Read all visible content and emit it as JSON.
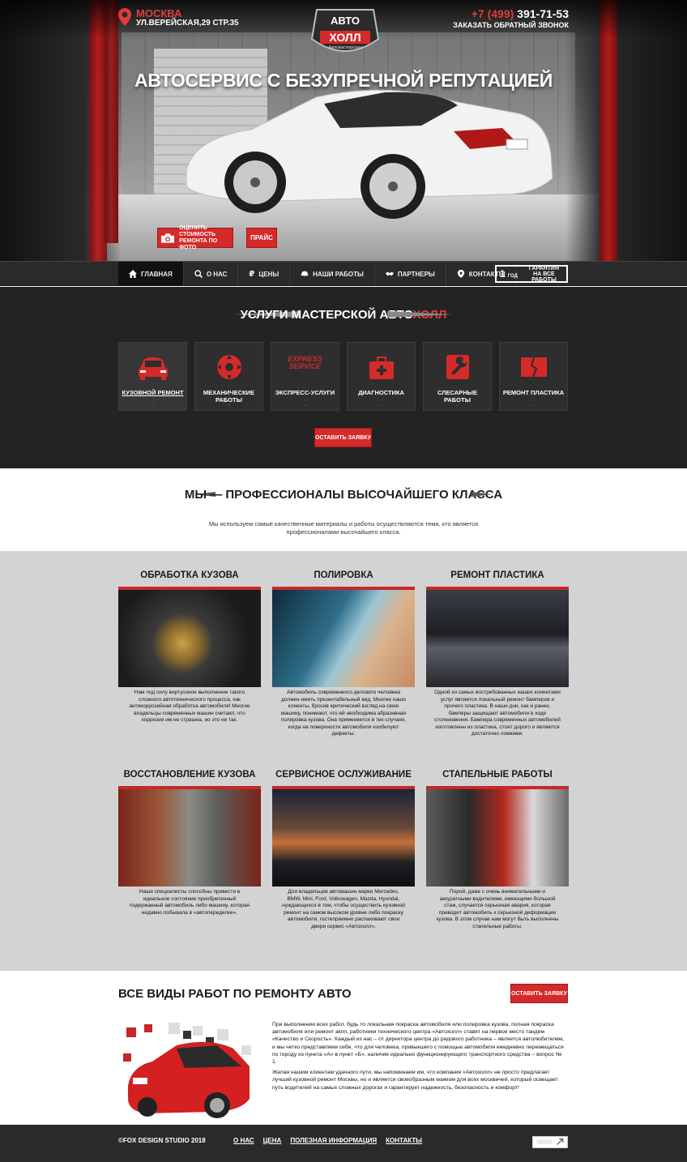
{
  "header": {
    "city": "МОСКВА",
    "address": "УЛ.ВЕРЕЙСКАЯ,29 СТР.35",
    "phone_prefix": "+7 (499)",
    "phone_number": "391-71-53",
    "callback": "ЗАКАЗАТЬ ОБРАТНЫЙ ЗВОНОК",
    "logo_top": "АВТО",
    "logo_bottom": "ХОЛЛ",
    "logo_sub": "Автомастерская"
  },
  "hero": {
    "title": "АВТОСЕРВИС С БЕЗУПРЕЧНОЙ РЕПУТАЦИЕЙ",
    "estimate_line1": "ОЦЕНИТЬ СТОИМОСТЬ",
    "estimate_line2": "РЕМОНТА ПО ФОТО",
    "price_btn": "ПРАЙС"
  },
  "nav": {
    "items": [
      {
        "label": "ГЛАВНАЯ",
        "icon": "home-icon"
      },
      {
        "label": "О НАС",
        "icon": "search-icon"
      },
      {
        "label": "ЦЕНЫ",
        "icon": "ruble-icon"
      },
      {
        "label": "НАШИ РАБОТЫ",
        "icon": "car-icon"
      },
      {
        "label": "ПАРТНЕРЫ",
        "icon": "handshake-icon"
      },
      {
        "label": "КОНТАКТЫ",
        "icon": "pin-icon"
      }
    ],
    "warranty_num": "1",
    "warranty_unit": "ГОД",
    "warranty_line1": "ГАРАНТИЯ",
    "warranty_line2": "НА ВСЕ РАБОТЫ"
  },
  "services": {
    "title_a": "УСЛУГИ МАСТЕРСКОЙ ",
    "title_b": "АВТО",
    "title_c": "ХОЛЛ",
    "express_line1": "EXPRESS",
    "express_line2": "SERVICE",
    "tiles": [
      {
        "label": "КУЗОВНОЙ РЕМОНТ",
        "icon": "car-front-icon"
      },
      {
        "label": "МЕХАНИЧЕСКИЕ РАБОТЫ",
        "icon": "saw-blade-icon"
      },
      {
        "label": "ЭКСПРЕСС-УСЛУГИ",
        "icon": "express-service-icon"
      },
      {
        "label": "ДИАГНОСТИКА",
        "icon": "first-aid-kit-icon"
      },
      {
        "label": "СЛЕСАРНЫЕ РАБОТЫ",
        "icon": "wrench-icon"
      },
      {
        "label": "РЕМОНТ ПЛАСТИКА",
        "icon": "plastic-panel-icon"
      }
    ],
    "order_btn": "ОСТАВИТЬ ЗАЯВКУ"
  },
  "pro": {
    "title": "МЫ — ПРОФЕССИОНАЛЫ ВЫСОЧАЙШЕГО КЛАССА",
    "desc": "Мы используем самые качественные материалы и работы осуществляются теми, кто является профессионалами высочайшего класса."
  },
  "cards": [
    {
      "title": "ОБРАБОТКА КУЗОВА",
      "text": "Нам под силу виртуозное выполнение такого сложного автотехнического процесса, как антикоррозийная обработка автомобиля! Многие владельцы современных машин считают, что коррозия им не страшна, но это не так."
    },
    {
      "title": "ПОЛИРОВКА",
      "text": "Автомобиль современного делового человека должен иметь презентабельный вид. Многие наши клиенты, бросив критический взгляд на свою машину, понимают, что ей необходима абразивная полировка кузова. Она применяется в тех случаях, когда на поверхности автомобиля изобилуют дефекты."
    },
    {
      "title": "РЕМОНТ ПЛАСТИКА",
      "text": "Одной из самых востребованных наших клиентами услуг является локальный ремонт бамперов и прочего пластика. В наши дни, как и ранее, бамперы защищают автомобили в ходе столкновения. Бампера современных автомобилей изготовлены из пластика, стоят дорого и являются достаточно ломкими."
    },
    {
      "title": "ВОССТАНОВЛЕНИЕ КУЗОВА",
      "text": "Наши специалисты способны привести в идеальное состояние приобретенный подержанный автомобиль либо машину, которая недавно побывала в «автопеределке»."
    },
    {
      "title": "СЕРВИСНОЕ ОСЛУЖИВАНИЕ",
      "text": "Для владельцев автомашин марки Mercedes, BMW, Mini, Ford, Volkswagen, Mazda, Hyundai, нуждающихся в том, чтобы осуществить кузовной ремонт на самом высоком уровне либо покраску автомобиля, гостеприимно распахивают свои двери сервис «Автохолл»."
    },
    {
      "title": "СТАПЕЛЬНЫЕ РАБОТЫ",
      "text": "Порой, даже с очень внимательными и аккуратными водителями, имеющими большой стаж, случается серьезная авария, которая приводит автомобиль к серьезной деформации кузова. В этом случае нам могут быть выполнены стапельные работы."
    }
  ],
  "works": {
    "title": "ВСЕ ВИДЫ РАБОТ ПО РЕМОНТУ АВТО",
    "order_btn": "ОСТАВИТЬ ЗАЯВКУ",
    "p1": "При выполнении всех работ, будь то локальная покраска автомобиля или полировка кузова, полная покраска автомобиля или ремонт акпп, работники технического центра «Автохолл» ставят на первое место тандем «Качество и Скорость». Каждый из нас – от директора центра до рядового работника – является автолюбителем, и мы четко представляем себе, что для человека, привыкшего с помощью автомобиля ежедневно перемещаться по городу из пункта «А» в пункт «Б», наличие идеально функционирующего транспортного средства – вопрос № 1.",
    "p2": "Желая нашим клиентам удачного пути, мы напоминаем им, что компания «Автохолл» не просто предлагает лучший кузовной ремонт Москвы, но и является своеобразным маяком для всех москвичей, который освещает путь водителей на самых сложных дорогах и гарантирует надежность, безопасность и комфорт!"
  },
  "footer": {
    "copyright": "©FOX DESIGN STUDIO 2018",
    "links": [
      "О НАС",
      "ЦЕНА",
      "ПОЛЕЗНАЯ ИНФОРМАЦИЯ",
      "КОНТАКТЫ"
    ]
  }
}
